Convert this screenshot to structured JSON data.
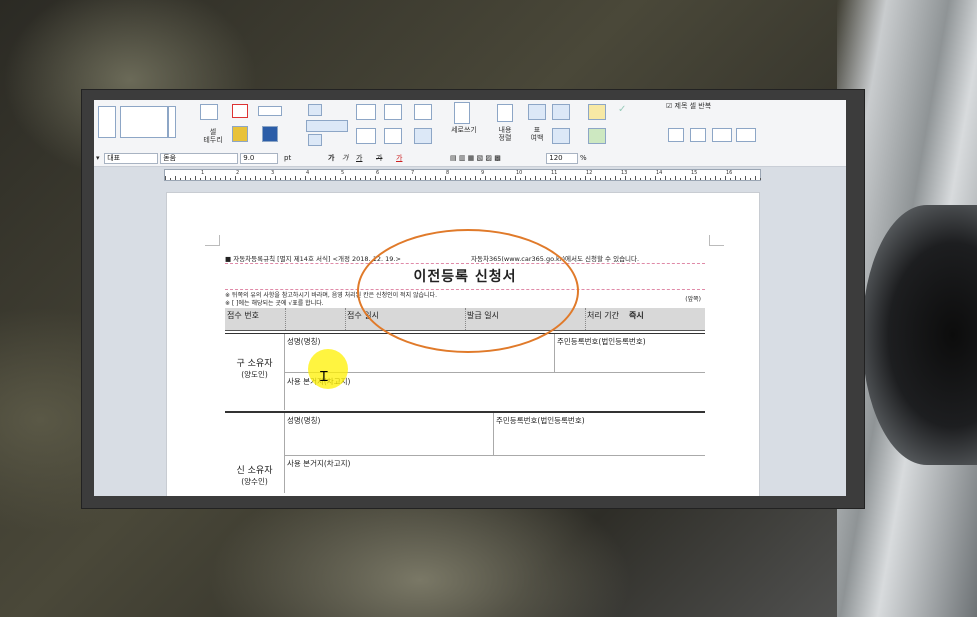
{
  "ribbon": {
    "cell_border_label": "셀\n테두리",
    "vertical_write_label": "세로쓰기",
    "content_align_label": "내용\n정렬",
    "table_margin_label": "표\n여백",
    "title_repeat_label": "제목 셀 반복"
  },
  "format_bar": {
    "style": "대표",
    "font": "돋움",
    "size": "9.0",
    "unit": "pt",
    "bold": "가",
    "italic": "가",
    "underline": "가",
    "strike": "가",
    "color": "가",
    "zoom": "120",
    "zoom_unit": "%"
  },
  "ruler": {
    "numbers": [
      "1",
      "2",
      "3",
      "4",
      "5",
      "6",
      "7",
      "8",
      "9",
      "10",
      "11",
      "12",
      "13",
      "14",
      "15",
      "16"
    ]
  },
  "form": {
    "header_left": "■ 자동차등록규칙 [별지 제14호 서식] <개정 2018. 12. 19.>",
    "header_right": "자동차365(www.car365.go.kr)에서도 신청할 수 있습니다.",
    "title": "이전등록 신청서",
    "note1": "※ 뒤쪽의 유의 사항을 참고하시기 바라며, 음영 처리된 칸은 신청인이 적지 않습니다.",
    "note2": "※ [ ]에는 해당되는 곳에 √표를 합니다.",
    "side": "(앞쪽)",
    "receipt_no": "접수 번호",
    "receipt_date": "접수 일시",
    "issue_date": "발급 일시",
    "processing_period": "처리 기간",
    "processing_value": "즉시",
    "old_owner": {
      "label": "구 소유자",
      "sub": "(양도인)",
      "name": "성명(명칭)",
      "id": "주민등록번호(법인등록번호)",
      "address": "사용 본거지(차고지)"
    },
    "new_owner": {
      "label": "신 소유자",
      "sub": "(양수인)",
      "name": "성명(명칭)",
      "id": "주민등록번호(법인등록번호)",
      "address": "사용 본거지(차고지)"
    }
  },
  "colors": {
    "annotation": "#e07a2a",
    "highlight": "#fff000",
    "accent_red": "#d0303a"
  }
}
